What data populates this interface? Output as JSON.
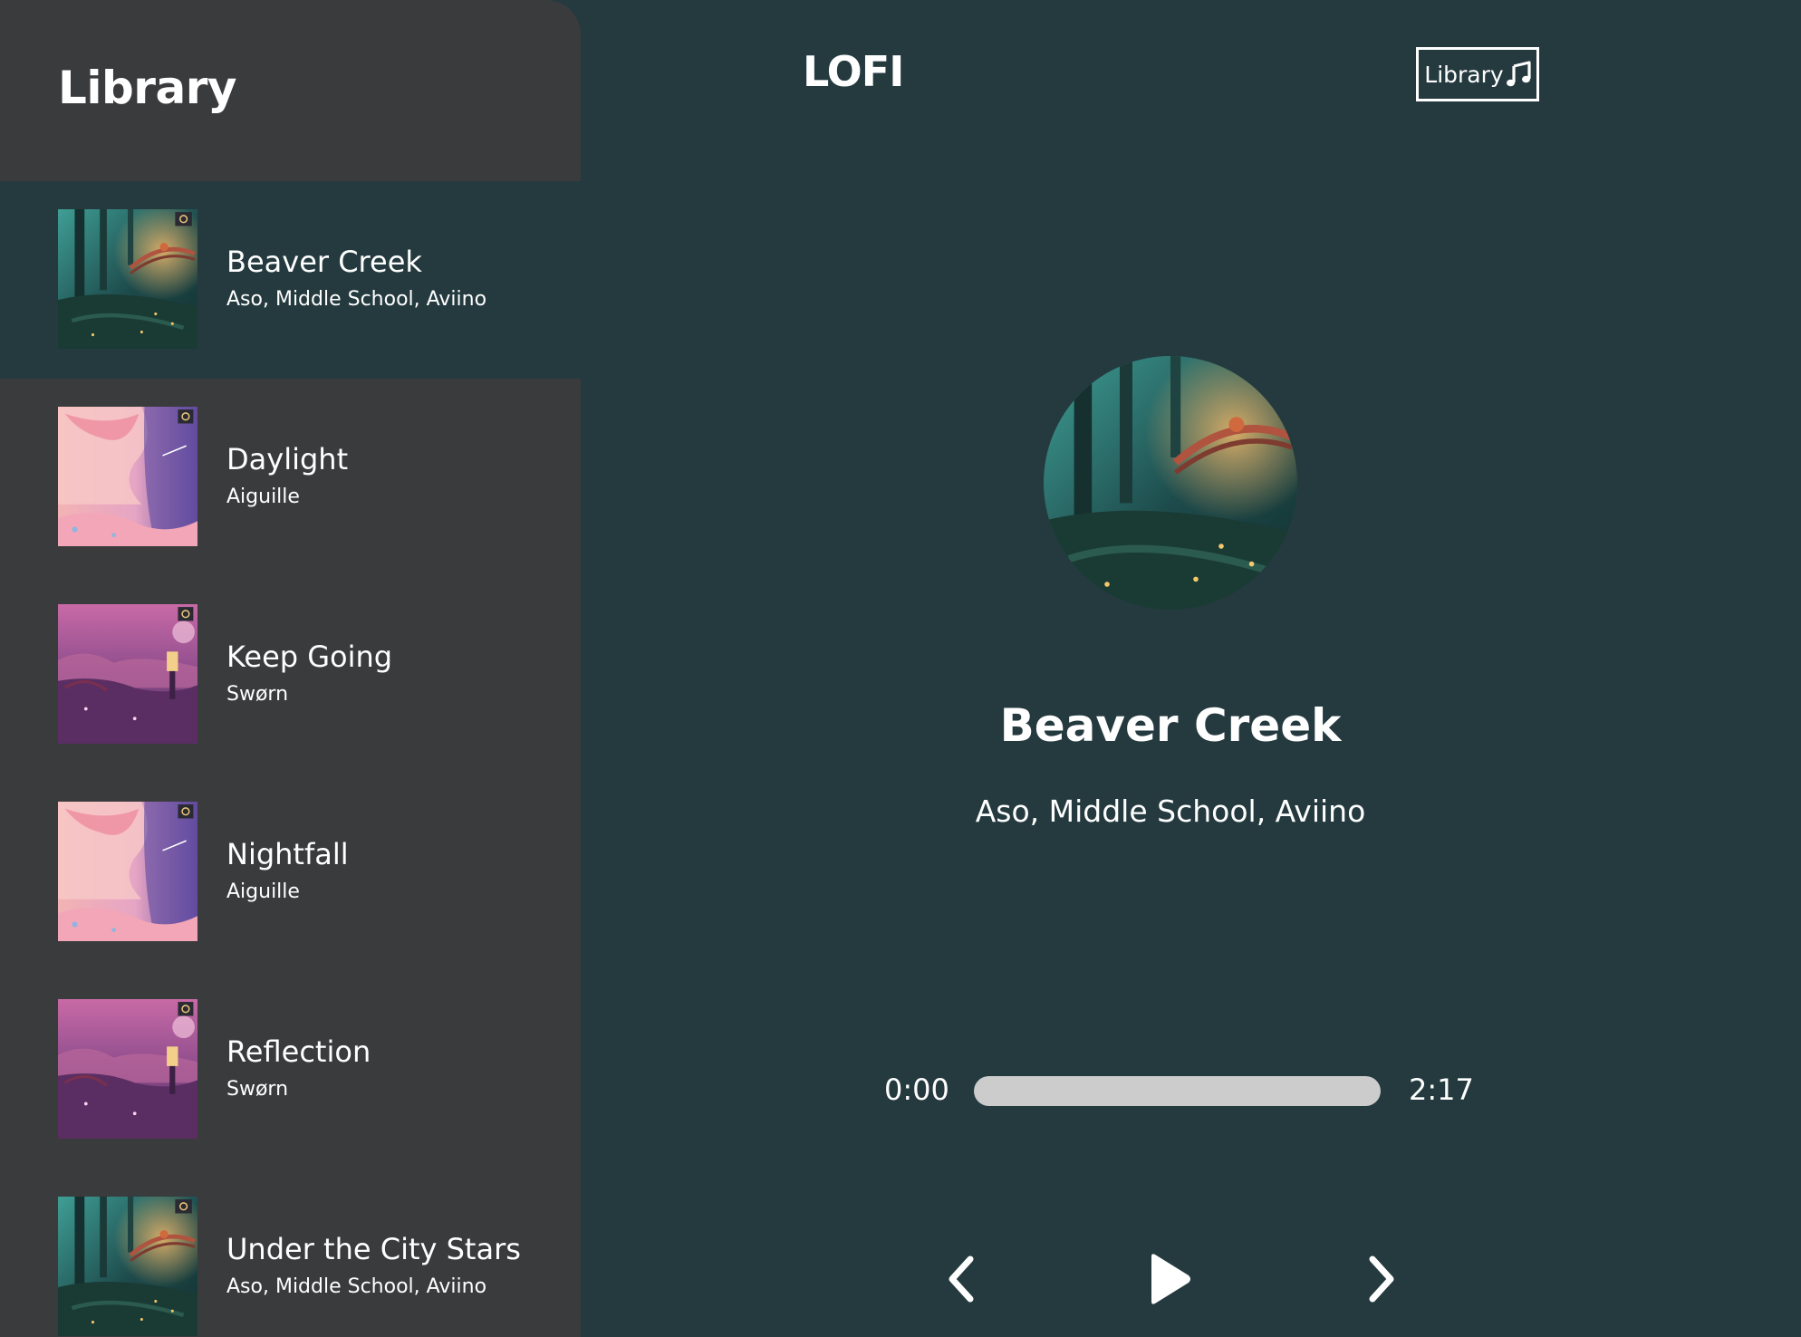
{
  "sidebar": {
    "title": "Library",
    "tracks": [
      {
        "name": "Beaver Creek",
        "artist": "Aso, Middle School, Aviino",
        "cover": "forest",
        "active": true
      },
      {
        "name": "Daylight",
        "artist": "Aiguille",
        "cover": "pink-sky",
        "active": false
      },
      {
        "name": "Keep Going",
        "artist": "Swørn",
        "cover": "purple-lantern",
        "active": false
      },
      {
        "name": "Nightfall",
        "artist": "Aiguille",
        "cover": "pink-sky",
        "active": false
      },
      {
        "name": "Reflection",
        "artist": "Swørn",
        "cover": "purple-lantern",
        "active": false
      },
      {
        "name": "Under the City Stars",
        "artist": "Aso, Middle School, Aviino",
        "cover": "forest",
        "active": false
      }
    ]
  },
  "header": {
    "app_title": "LOFI",
    "library_button_label": "Library",
    "library_button_icon": "music-note-icon"
  },
  "now_playing": {
    "title": "Beaver Creek",
    "artist": "Aso, Middle School, Aviino",
    "cover": "forest",
    "time_current": "0:00",
    "time_total": "2:17",
    "progress": 0
  },
  "controls": {
    "prev_icon": "chevron-left-icon",
    "play_icon": "play-icon",
    "next_icon": "chevron-right-icon"
  },
  "colors": {
    "background": "#243a3f",
    "sidebar": "#3a3b3d",
    "active_row": "#243a3f",
    "progress_track": "#cccccc",
    "text": "#ffffff"
  }
}
